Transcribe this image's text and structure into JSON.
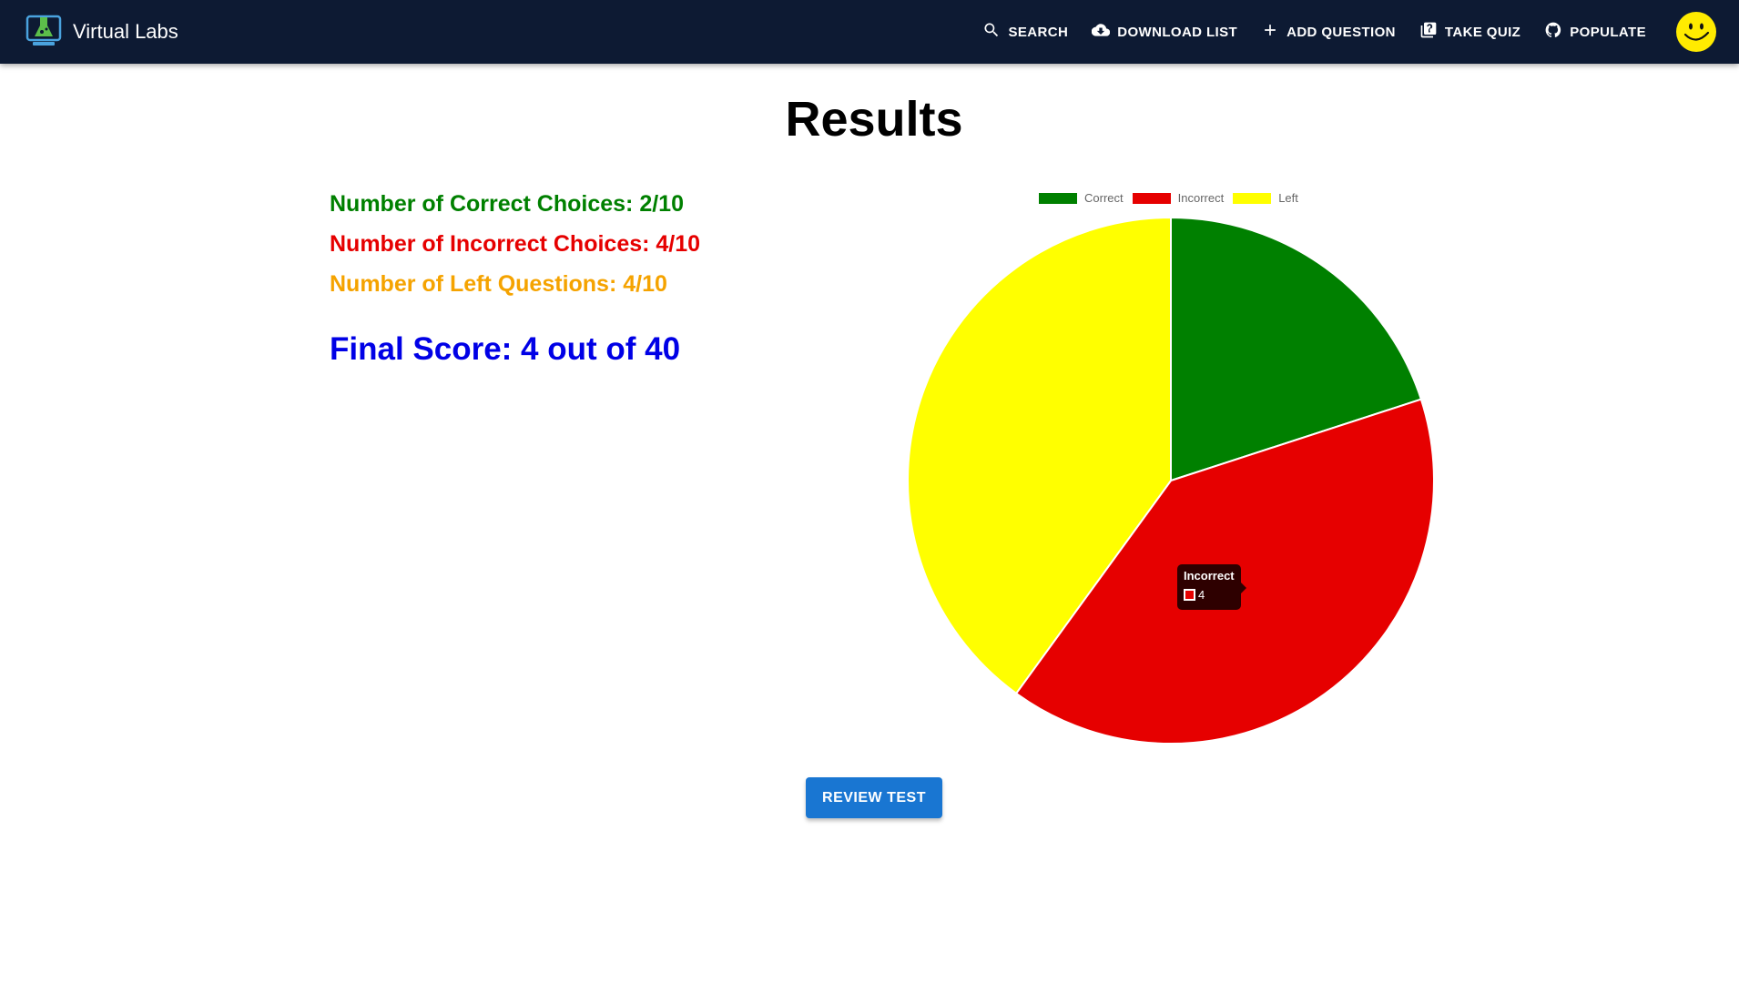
{
  "app": {
    "title": "Virtual Labs",
    "nav": [
      {
        "label": "SEARCH",
        "icon": "search-icon"
      },
      {
        "label": "DOWNLOAD LIST",
        "icon": "cloud-download-icon"
      },
      {
        "label": "ADD QUESTION",
        "icon": "plus-icon"
      },
      {
        "label": "TAKE QUIZ",
        "icon": "quiz-icon"
      },
      {
        "label": "POPULATE",
        "icon": "github-icon"
      }
    ],
    "colors": {
      "appbar": "#0d1a33",
      "accent": "#1976d2"
    }
  },
  "results": {
    "title": "Results",
    "correct_text": "Number of Correct Choices: 2/10",
    "incorrect_text": "Number of Incorrect Choices: 4/10",
    "left_text": "Number of Left Questions: 4/10",
    "final_text": "Final Score: 4 out of 40",
    "colors": {
      "correct": "#008000",
      "incorrect": "#e60000",
      "left": "#f5a300",
      "final": "#0000e6"
    }
  },
  "chart_data": {
    "type": "pie",
    "categories": [
      "Correct",
      "Incorrect",
      "Left"
    ],
    "values": [
      2,
      4,
      4
    ],
    "colors": [
      "#008000",
      "#e60000",
      "#ffff00"
    ],
    "legend_position": "top",
    "tooltip": {
      "label": "Incorrect",
      "value": "4"
    }
  },
  "actions": {
    "review_label": "REVIEW TEST"
  }
}
